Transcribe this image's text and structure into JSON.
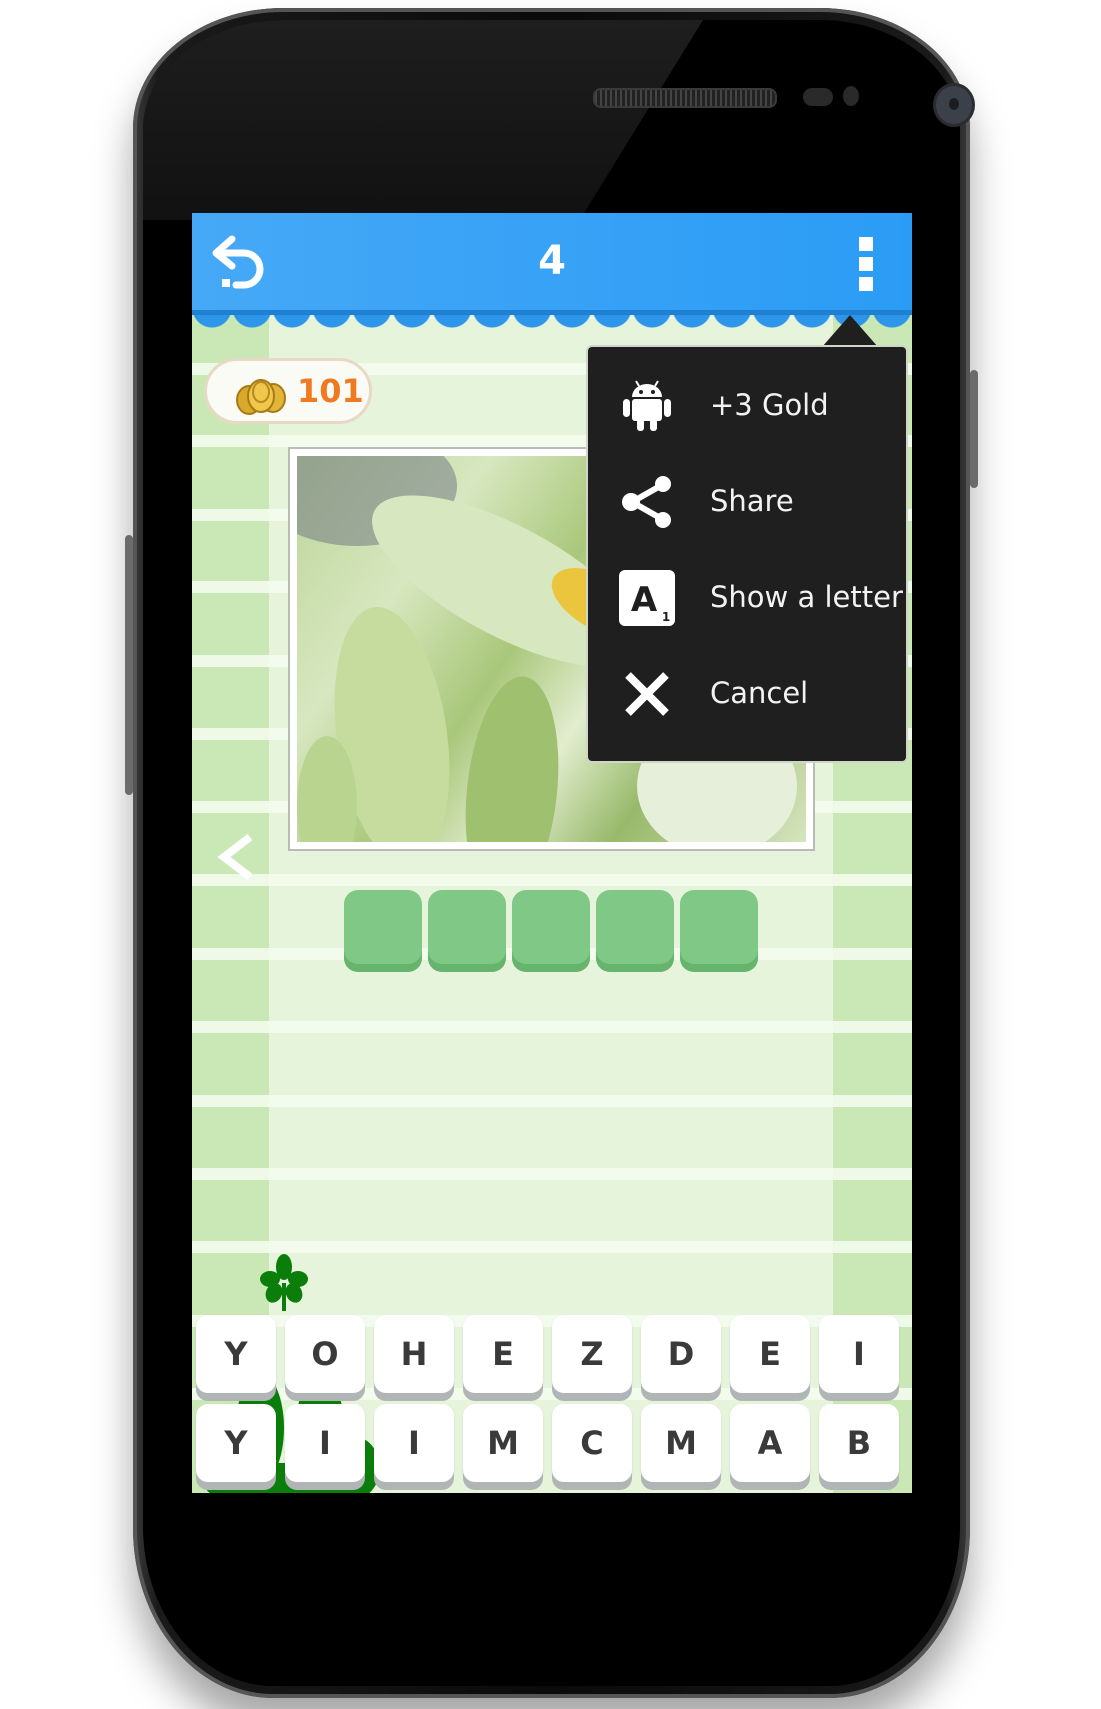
{
  "device": {
    "frame": "android-phone"
  },
  "action_bar": {
    "title": "4",
    "back_icon": "undo-arrow-icon",
    "overflow_icon": "more-vertical-icon",
    "color": "#3aa3f6"
  },
  "coins": {
    "count": "101",
    "icon": "gold-coins-icon",
    "color": "#f07a22"
  },
  "puzzle": {
    "image_description": "Corn cobs in husks",
    "answer_length": 5,
    "answer_tiles": [
      "",
      "",
      "",
      "",
      ""
    ],
    "prev_icon": "chevron-left-icon"
  },
  "keyboard": {
    "row1": [
      "Y",
      "O",
      "H",
      "E",
      "Z",
      "D",
      "E",
      "I"
    ],
    "row2": [
      "Y",
      "I",
      "I",
      "M",
      "C",
      "M",
      "A",
      "B"
    ]
  },
  "overflow_menu": {
    "items": [
      {
        "label": "+3 Gold",
        "icon": "android-icon"
      },
      {
        "label": "Share",
        "icon": "share-icon"
      },
      {
        "label": "Show a letter",
        "icon": "letter-tile-icon"
      },
      {
        "label": "Cancel",
        "icon": "close-icon"
      }
    ]
  },
  "decor": {
    "clover_color": "#0a7d0a"
  }
}
